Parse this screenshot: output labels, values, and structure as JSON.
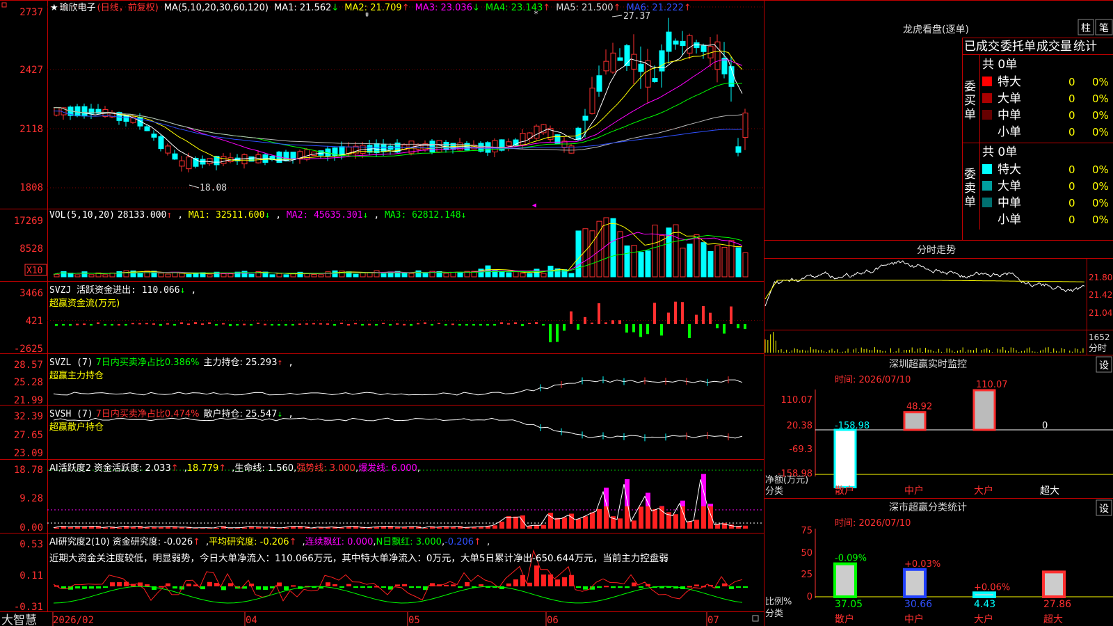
{
  "stock": {
    "star": "★",
    "name": "瑜欣电子",
    "mode": "(日线，前复权)"
  },
  "kline": {
    "axis": [
      "2737",
      "2427",
      "2118",
      "1808"
    ],
    "ma_title": "MA(5,10,20,30,60,120)",
    "ma": [
      {
        "label": "MA1: 21.562",
        "arrow": "↓",
        "color": "#ffffff"
      },
      {
        "label": "MA2: 21.709",
        "arrow": "↑",
        "color": "#ffff00"
      },
      {
        "label": "MA3: 23.036",
        "arrow": "↓",
        "color": "#ff00ff"
      },
      {
        "label": "MA4: 23.143",
        "arrow": "↑",
        "color": "#00ff00"
      },
      {
        "label": "MA5: 21.500",
        "arrow": "↑",
        "color": "#dddddd"
      },
      {
        "label": "MA6: 21.222",
        "arrow": "↑",
        "color": "#3050ff"
      }
    ],
    "high_mark": "27.37",
    "low_mark": "18.08"
  },
  "vol": {
    "axis": [
      "17269",
      "8528"
    ],
    "unit": "X10",
    "title": "VOL(5,10,20)",
    "value": "28133.000",
    "ma1": "MA1: 32511.600",
    "ma2": "MA2: 45635.301",
    "ma3": "MA3: 62812.148"
  },
  "svzj": {
    "axis": [
      "3466",
      "421",
      "-2625"
    ],
    "line1": "SVZJ  活跃资金进出: 110.066",
    "line2": "超赢资金流(万元)"
  },
  "svzl": {
    "axis": [
      "28.57",
      "25.28",
      "21.99"
    ],
    "prefix": "SVZL (7)",
    "ratio": "7日内买卖净占比0.386%",
    "hold": "主力持仓: 25.293",
    "sub": "超赢主力持仓"
  },
  "svsh": {
    "axis": [
      "32.39",
      "27.65",
      "23.09"
    ],
    "prefix": "SVSH (7)",
    "ratio": "7日内买卖净占比0.474%",
    "hold": "散户持仓: 25.547",
    "sub": "超赢散户持仓"
  },
  "ai1": {
    "axis": [
      "18.78",
      "9.28",
      "0.00"
    ],
    "title": "AI活跃度2",
    "act": "资金活跃度: 2.033",
    "v2": "18.779",
    "life": "生命线: 1.560",
    "strong": "强势线: 3.000",
    "burst": "爆发线: 6.000"
  },
  "ai2": {
    "axis": [
      "0.53",
      "0.11",
      "-0.31"
    ],
    "title": "AI研究度2(10)",
    "res": "资金研究度: -0.026",
    "avg": "平均研究度: -0.206",
    "red": "连续飘红: 0.000",
    "nred": "N日飘红: 3.000",
    "last": "-0.206",
    "summary": "近期大资金关注度较低，明显弱势，今日大单净流入：110.066万元，其中特大单净流入：0万元，大单5日累计净出-650.644万元，当前主力控盘弱"
  },
  "xaxis": {
    "brand": "大智慧",
    "labels": [
      "2026/02",
      "04",
      "05",
      "06",
      "07"
    ]
  },
  "lhb": {
    "title": "龙虎看盘(逐单)",
    "btn_zhu": "柱",
    "btn_bi": "笔",
    "tabs": [
      "已成交",
      "委托单",
      "成交量",
      "统计"
    ],
    "buy_label": "委买单",
    "sell_label": "委卖单",
    "buy_total": "共 0单",
    "sell_total": "共 0单",
    "buy_rows": [
      {
        "name": "特大",
        "n": "0",
        "p": "0%",
        "color": "#ff0000"
      },
      {
        "name": "大单",
        "n": "0",
        "p": "0%",
        "color": "#aa0000"
      },
      {
        "name": "中单",
        "n": "0",
        "p": "0%",
        "color": "#660000"
      },
      {
        "name": "小单",
        "n": "0",
        "p": "0%",
        "color": "#000000"
      }
    ],
    "sell_rows": [
      {
        "name": "特大",
        "n": "0",
        "p": "0%",
        "color": "#00ffff"
      },
      {
        "name": "大单",
        "n": "0",
        "p": "0%",
        "color": "#00a0a0"
      },
      {
        "name": "中单",
        "n": "0",
        "p": "0%",
        "color": "#007070"
      },
      {
        "name": "小单",
        "n": "0",
        "p": "0%",
        "color": "#000000"
      }
    ]
  },
  "fenshi": {
    "title": "分时走势",
    "axis": [
      "21.80",
      "21.42",
      "21.04"
    ],
    "vol_axis": "1652",
    "vol_label": "分时"
  },
  "monitor": {
    "title": "深圳超赢实时监控",
    "btn": "设",
    "time": "时间: 2026/07/10",
    "axis": [
      "110.07",
      "20.38",
      "-69.3",
      "-158.98"
    ],
    "unit": "净额(万元)",
    "cat_label": "分类",
    "cats": [
      "散户",
      "中户",
      "大户",
      "超大"
    ],
    "values": [
      "-158.98",
      "48.92",
      "110.07",
      "0"
    ]
  },
  "stats": {
    "title": "深市超赢分类统计",
    "btn": "设",
    "time": "时间: 2026/07/10",
    "axis": [
      "75",
      "50",
      "25",
      "0"
    ],
    "unit": "比例%",
    "cat_label": "分类",
    "cats": [
      "散户",
      "中户",
      "大户",
      "超大"
    ],
    "changes": [
      "-0.09%",
      "+0.03%",
      "+0.06%",
      ""
    ],
    "values": [
      "37.05",
      "30.66",
      "4.43",
      "27.86"
    ]
  }
}
